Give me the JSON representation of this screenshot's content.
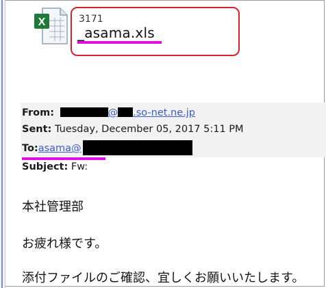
{
  "attachment": {
    "number": "3171",
    "filename": "_asama.xls",
    "icon": "excel-file-icon"
  },
  "email": {
    "from_label": "From:",
    "from_domain": ".so-net.ne.jp",
    "from_at": "@",
    "sent_label": "Sent:",
    "sent_value": "Tuesday, December 05, 2017 5:11 PM",
    "to_label": "To:",
    "to_value": "asama@",
    "subject_label": "Subject:",
    "subject_value": "Fw:"
  },
  "body": {
    "line1": "本社管理部",
    "line2": "お疲れ様です。",
    "line3": "添付ファイルのご確認、宜しくお願いいたします。"
  },
  "colors": {
    "highlight_box": "#d81f2a",
    "underline": "#e010e0",
    "link": "#3a5bc8"
  }
}
